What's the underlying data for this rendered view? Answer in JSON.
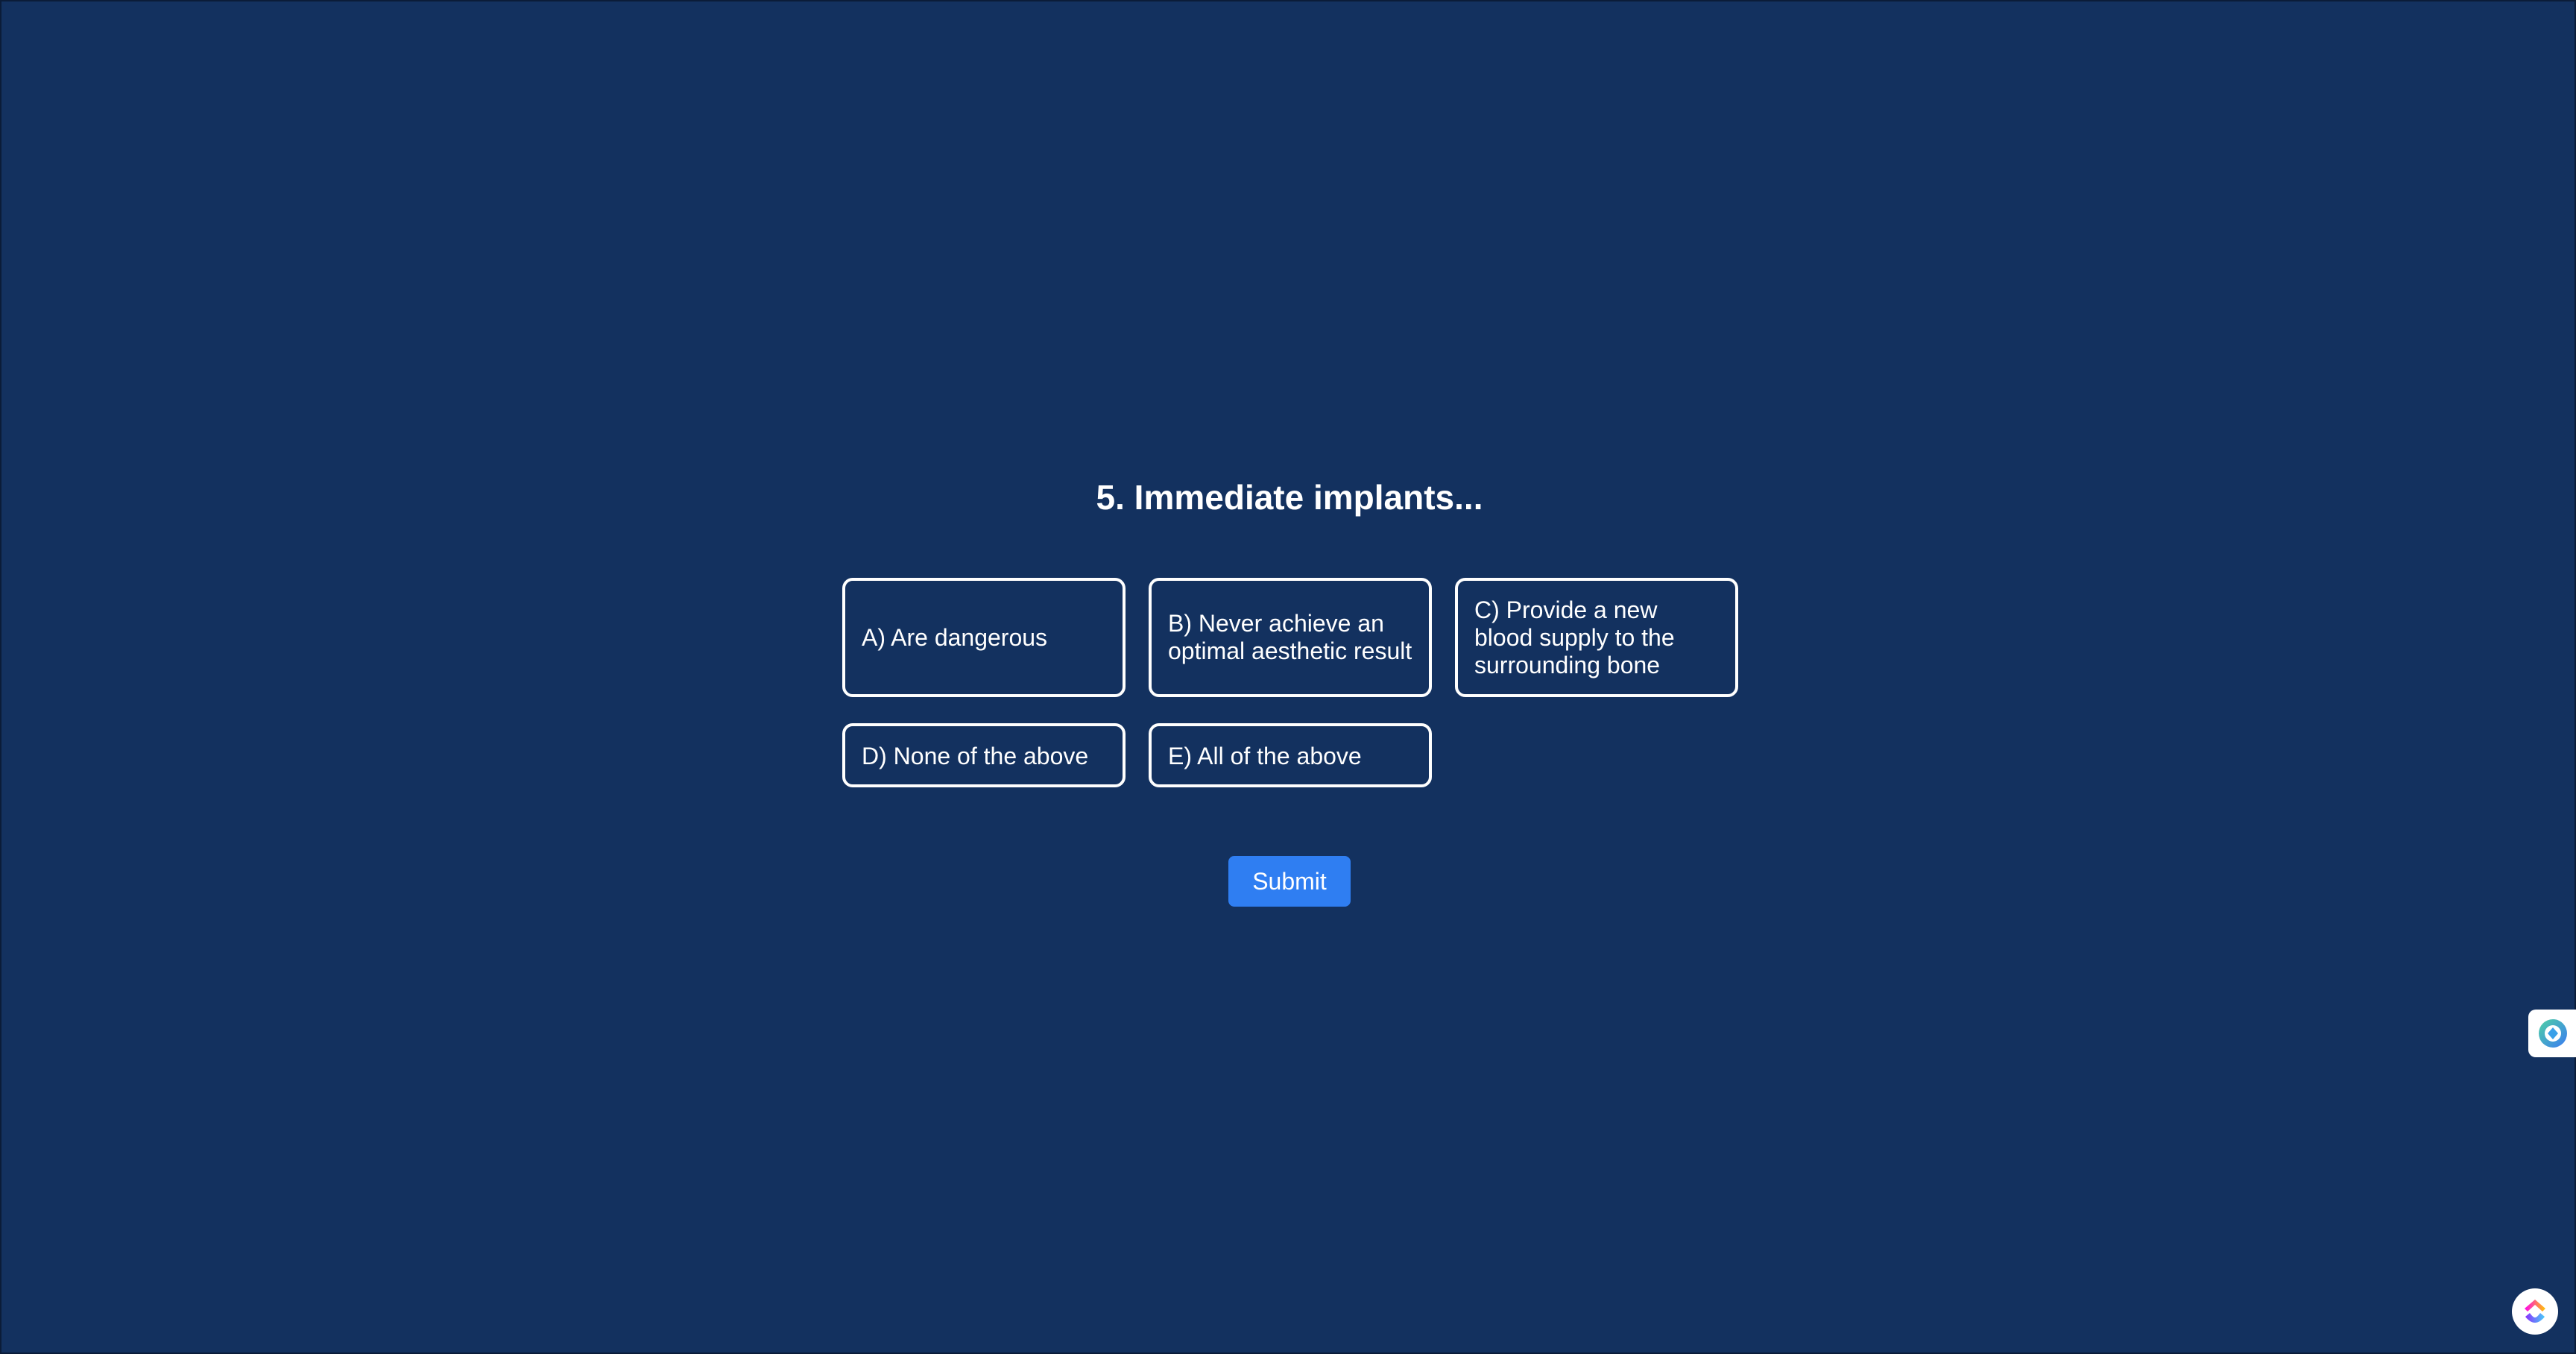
{
  "question": {
    "title": "5. Immediate implants..."
  },
  "options": [
    {
      "label": "A) Are dangerous"
    },
    {
      "label": "B) Never achieve an optimal aesthetic result"
    },
    {
      "label": "C) Provide a new blood supply to the surrounding bone"
    },
    {
      "label": "D) None of the above"
    },
    {
      "label": "E) All of the above"
    }
  ],
  "submit": {
    "label": "Submit"
  },
  "widgets": {
    "side_icon": "assistant-icon",
    "corner_icon": "app-logo-icon"
  },
  "colors": {
    "background": "#13315f",
    "accent": "#2f7ef2",
    "text": "#ffffff"
  }
}
